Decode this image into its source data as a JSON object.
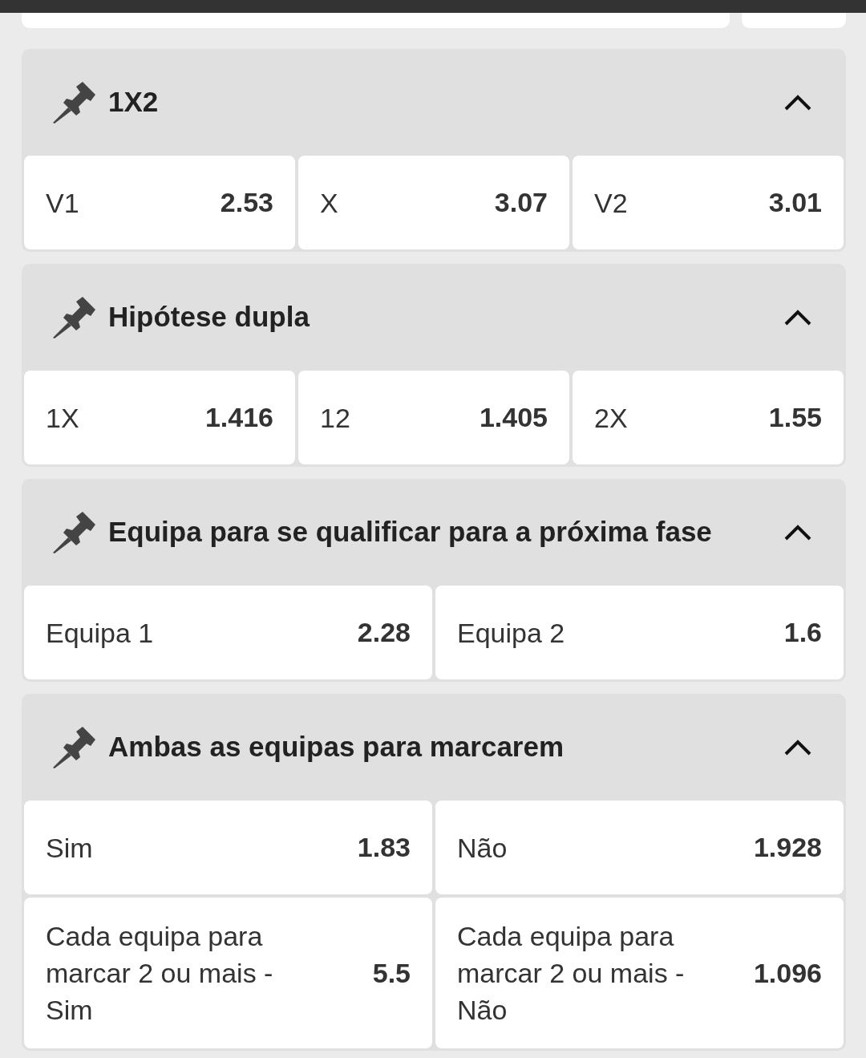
{
  "markets": [
    {
      "title": "1X2",
      "expanded": true,
      "odds": [
        {
          "label": "V1",
          "value": "2.53"
        },
        {
          "label": "X",
          "value": "3.07"
        },
        {
          "label": "V2",
          "value": "3.01"
        }
      ]
    },
    {
      "title": "Hipótese dupla",
      "expanded": true,
      "odds": [
        {
          "label": "1X",
          "value": "1.416"
        },
        {
          "label": "12",
          "value": "1.405"
        },
        {
          "label": "2X",
          "value": "1.55"
        }
      ]
    },
    {
      "title": "Equipa para se qualificar para a próxima fase",
      "expanded": true,
      "odds": [
        {
          "label": "Equipa 1",
          "value": "2.28"
        },
        {
          "label": "Equipa 2",
          "value": "1.6"
        }
      ]
    },
    {
      "title": "Ambas as equipas para marcarem",
      "expanded": true,
      "odds": [
        {
          "label": "Sim",
          "value": "1.83"
        },
        {
          "label": "Não",
          "value": "1.928"
        },
        {
          "label": "Cada equipa para marcar 2 ou mais - Sim",
          "value": "5.5"
        },
        {
          "label": "Cada equipa para marcar 2 ou mais - Não",
          "value": "1.096"
        }
      ]
    }
  ]
}
